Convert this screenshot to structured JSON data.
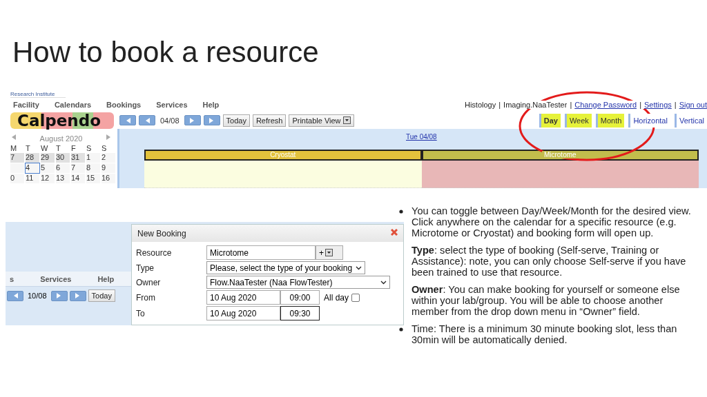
{
  "title": "How to book a resource",
  "top_screenshot": {
    "org": "Research Institute",
    "menu": [
      "Facility",
      "Calendars",
      "Bookings",
      "Services",
      "Help"
    ],
    "user_links": [
      {
        "label": "Histology",
        "link": false
      },
      {
        "label": "Imaging.NaaTester",
        "link": false
      },
      {
        "label": "Change Password",
        "link": true
      },
      {
        "label": "Settings",
        "link": true
      },
      {
        "label": "Sign out",
        "link": true
      }
    ],
    "link_separator": "|",
    "logo": "Calpendo",
    "nav_date": "04/08",
    "toolbar_buttons": [
      "Today",
      "Refresh",
      "Printable View"
    ],
    "view_tabs": [
      {
        "label": "Day",
        "selected": true,
        "highlighted": true
      },
      {
        "label": "Week",
        "selected": false,
        "highlighted": true
      },
      {
        "label": "Month",
        "selected": false,
        "highlighted": true
      },
      {
        "label": "Horizontal",
        "selected": false,
        "highlighted": false
      },
      {
        "label": "Vertical",
        "selected": false,
        "highlighted": false
      }
    ],
    "mini_calendar": {
      "month": "August 2020",
      "weekdays": [
        "M",
        "T",
        "W",
        "T",
        "F",
        "S",
        "S"
      ],
      "weeks": [
        [
          {
            "label": "7",
            "other_month": true,
            "selected": false
          },
          {
            "label": "28",
            "other_month": true,
            "selected": false
          },
          {
            "label": "29",
            "other_month": true,
            "selected": false
          },
          {
            "label": "30",
            "other_month": true,
            "selected": false
          },
          {
            "label": "31",
            "other_month": true,
            "selected": false
          },
          {
            "label": "1",
            "other_month": false,
            "selected": false
          },
          {
            "label": "2",
            "other_month": false,
            "selected": false
          }
        ],
        [
          {
            "other_month": false,
            "selected": false
          },
          {
            "label": "4",
            "other_month": false,
            "selected": true
          },
          {
            "label": "5",
            "other_month": false,
            "selected": false
          },
          {
            "label": "6",
            "other_month": false,
            "selected": false
          },
          {
            "label": "7",
            "other_month": false,
            "selected": false
          },
          {
            "label": "8",
            "other_month": false,
            "selected": false
          },
          {
            "label": "9",
            "other_month": false,
            "selected": false
          }
        ],
        [
          {
            "label": "0",
            "other_month": false,
            "selected": false
          },
          {
            "label": "11",
            "other_month": false,
            "selected": false
          },
          {
            "label": "12",
            "other_month": false,
            "selected": false
          },
          {
            "label": "13",
            "other_month": false,
            "selected": false
          },
          {
            "label": "14",
            "other_month": false,
            "selected": false
          },
          {
            "label": "15",
            "other_month": false,
            "selected": false
          },
          {
            "label": "16",
            "other_month": false,
            "selected": false
          }
        ]
      ]
    },
    "day_label": "Tue 04/08",
    "resources": [
      {
        "name": "Cryostat",
        "color": "#e3c23c"
      },
      {
        "name": "Microtome",
        "color": "#c2bd4c"
      }
    ]
  },
  "bottom_screenshot": {
    "menu": [
      "s",
      "Services",
      "Help"
    ],
    "nav_date": "10/08",
    "today": "Today",
    "dialog": {
      "title": "New Booking",
      "resource": {
        "label": "Resource",
        "value": "Microtome",
        "add": "+"
      },
      "type": {
        "label": "Type",
        "value": "Please, select the type of your booking"
      },
      "owner": {
        "label": "Owner",
        "value": "Flow.NaaTester (Naa FlowTester)"
      },
      "from": {
        "label": "From",
        "date": "10 Aug 2020",
        "time": "09:00"
      },
      "all_day": {
        "label": "All day",
        "checked": false
      },
      "to": {
        "label": "To",
        "date": "10 Aug 2020",
        "time": "09:30"
      }
    }
  },
  "bullets": [
    "You can toggle between Day/Week/Month for the desired view. Click anywhere on the calendar for a specific resource (e.g. Microtome or Cryostat) and booking form will open up.",
    "**Type**: select the type of booking (Self-serve, Training or Assistance): note, you can only choose Self-serve if you have been trained to use that resource.",
    "**Owner**: You can make booking for yourself or someone else within your lab/group. You will be able to choose another member from the drop down menu in “Owner” field.",
    "Time: There is a minimum 30 minute booking slot, less than 30min will be automatically denied."
  ]
}
